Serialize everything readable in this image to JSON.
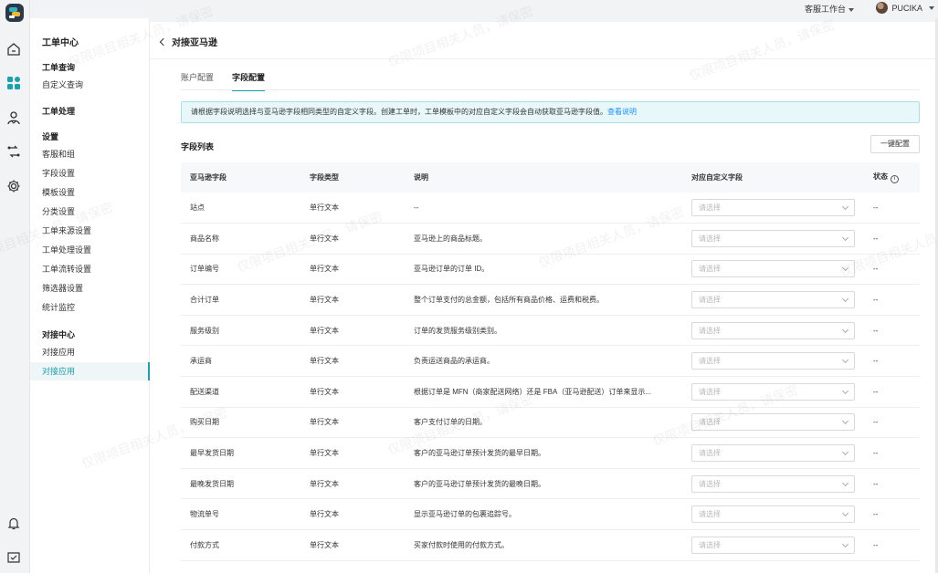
{
  "topbar": {
    "workspace_label": "客服工作台",
    "user_name": "PUCIKA"
  },
  "sidebar": {
    "title": "工单中心",
    "sections": [
      {
        "label": "工单查询"
      },
      {
        "label": "工单处理"
      },
      {
        "label": "设置"
      },
      {
        "label": "对接中心"
      }
    ],
    "items": [
      {
        "label": "自定义查询"
      },
      {
        "label": "客服和组"
      },
      {
        "label": "字段设置"
      },
      {
        "label": "模板设置"
      },
      {
        "label": "分类设置"
      },
      {
        "label": "工单来源设置"
      },
      {
        "label": "工单处理设置"
      },
      {
        "label": "工单流转设置"
      },
      {
        "label": "筛选器设置"
      },
      {
        "label": "统计监控"
      },
      {
        "label": "对接应用"
      },
      {
        "label": "对接应用"
      }
    ]
  },
  "page": {
    "title": "对接亚马逊",
    "tabs": [
      {
        "label": "账户配置",
        "active": false
      },
      {
        "label": "字段配置",
        "active": true
      }
    ],
    "notice": {
      "text": "请根据字段说明选择与亚马逊字段相同类型的自定义字段。创建工单时，工单模板中的对应自定义字段会自动获取亚马逊字段值。",
      "link": "查看说明"
    },
    "list_title": "字段列表",
    "config_button": "一键配置"
  },
  "table": {
    "headers": {
      "amazon_field": "亚马逊字段",
      "field_type": "字段类型",
      "description": "说明",
      "custom_field": "对应自定义字段",
      "status": "状态"
    },
    "select_placeholder": "请选择",
    "rows": [
      {
        "amazon_field": "站点",
        "field_type": "单行文本",
        "description": "--",
        "status": "--"
      },
      {
        "amazon_field": "商品名称",
        "field_type": "单行文本",
        "description": "亚马逊上的商品标题。",
        "status": "--"
      },
      {
        "amazon_field": "订单编号",
        "field_type": "单行文本",
        "description": "亚马逊订单的订单 ID。",
        "status": "--"
      },
      {
        "amazon_field": "合计订单",
        "field_type": "单行文本",
        "description": "整个订单支付的总金额，包括所有商品价格、运费和税费。",
        "status": "--"
      },
      {
        "amazon_field": "服务级别",
        "field_type": "单行文本",
        "description": "订单的发货服务级别类别。",
        "status": "--"
      },
      {
        "amazon_field": "承运商",
        "field_type": "单行文本",
        "description": "负责运送商品的承运商。",
        "status": "--"
      },
      {
        "amazon_field": "配送渠道",
        "field_type": "单行文本",
        "description": "根据订单是 MFN（商家配送网络）还是 FBA（亚马逊配送）订单来显示...",
        "status": "--"
      },
      {
        "amazon_field": "购买日期",
        "field_type": "单行文本",
        "description": "客户支付订单的日期。",
        "status": "--"
      },
      {
        "amazon_field": "最早发货日期",
        "field_type": "单行文本",
        "description": "客户的亚马逊订单预计发货的最早日期。",
        "status": "--"
      },
      {
        "amazon_field": "最晚发货日期",
        "field_type": "单行文本",
        "description": "客户的亚马逊订单预计发货的最晚日期。",
        "status": "--"
      },
      {
        "amazon_field": "物流单号",
        "field_type": "单行文本",
        "description": "显示亚马逊订单的包裹追踪号。",
        "status": "--"
      },
      {
        "amazon_field": "付款方式",
        "field_type": "单行文本",
        "description": "买家付款时使用的付款方式。",
        "status": "--"
      }
    ]
  },
  "watermark": "仅限项目相关人员，请保密",
  "colors": {
    "accent": "#1aa0b0",
    "link": "#1890ff",
    "notice_bg": "#e8f8fa"
  }
}
